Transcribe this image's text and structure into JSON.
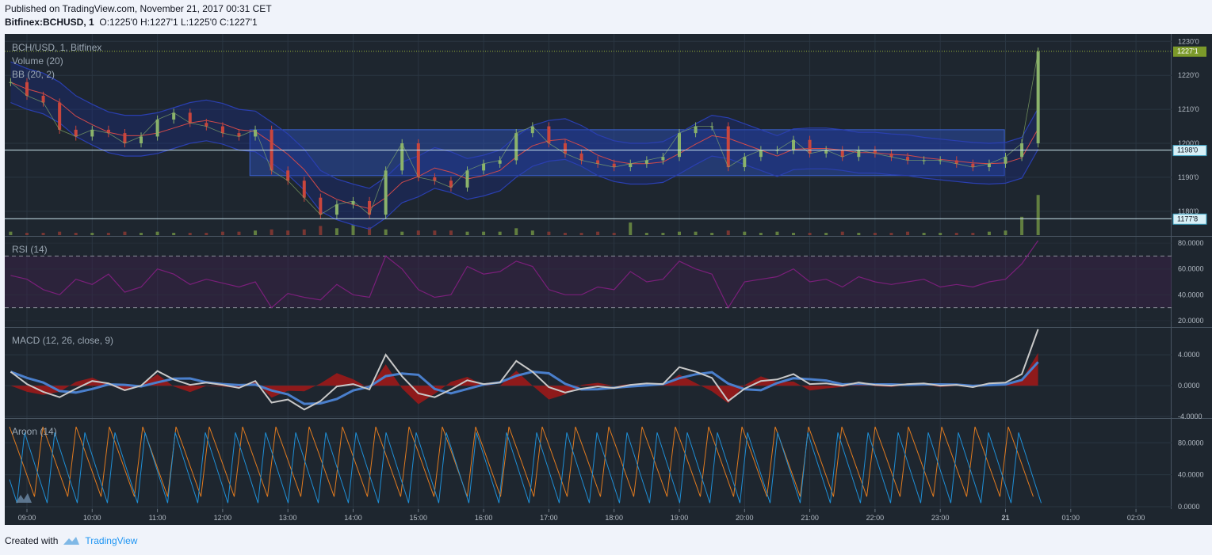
{
  "header": {
    "published": "Published on TradingView.com, November 21, 2017 00:31 CET",
    "symbol": "Bitfinex:BCHUSD, 1",
    "ohlc": "O:1225'0 H:1227'1 L:1225'0 C:1227'1"
  },
  "footer": {
    "created_with": "Created with",
    "brand": "TradingView"
  },
  "colors": {
    "background": "#1e262f",
    "grid": "#2a3642",
    "candle_up": "#8bb36b",
    "candle_down": "#c9463d",
    "bb_band": "#1a2d8c",
    "bb_mid": "#d24a4a",
    "box": "#2a4aa8",
    "hline": "#cce6ef",
    "rsi": "#7a1f7a",
    "macd": "#c8c8c8",
    "signal": "#4a7fcc",
    "hist": "#9b1a1a",
    "aroon_up": "#e07a1f",
    "aroon_down": "#1f8fd6",
    "last_price_tag": "#7c9a2a"
  },
  "price_pane": {
    "title": "BCH/USD, 1, Bitfinex",
    "volume_label": "Volume (20)",
    "bb_label": "BB (20, 2)",
    "ticks": [
      "1230'0",
      "1220'0",
      "1210'0",
      "1200'0",
      "1190'0",
      "1180'0"
    ],
    "last_price": "1227'1",
    "levels": [
      {
        "label": "1198'0",
        "value": 1198.0
      },
      {
        "label": "1177'8",
        "value": 1177.8
      }
    ],
    "range": [
      1173,
      1232
    ],
    "box": {
      "from": "12:25",
      "to": "23:59",
      "low": 1190.5,
      "high": 1204.0
    }
  },
  "rsi_pane": {
    "label": "RSI (14)",
    "ticks": [
      "80.0000",
      "60.0000",
      "40.0000",
      "20.0000"
    ],
    "range": [
      15,
      85
    ],
    "upper": 70,
    "lower": 30
  },
  "macd_pane": {
    "label": "MACD (12, 26, close, 9)",
    "ticks": [
      "4.0000",
      "0.0000",
      "-4.0000"
    ],
    "range": [
      -4.2,
      7.5
    ]
  },
  "aroon_pane": {
    "label": "Aroon (14)",
    "ticks": [
      "80.0000",
      "40.0000",
      "0.0000"
    ],
    "range": [
      -3,
      110
    ]
  },
  "time_axis": [
    "09:00",
    "10:00",
    "11:00",
    "12:00",
    "13:00",
    "14:00",
    "15:00",
    "16:00",
    "17:00",
    "18:00",
    "19:00",
    "20:00",
    "21:00",
    "22:00",
    "23:00",
    "21",
    "01:00",
    "02:00"
  ],
  "chart_data": {
    "type": "line",
    "title": "BCH/USD, 1, Bitfinex",
    "xlabel": "",
    "ylabel": "",
    "x_ticks": [
      "09:00",
      "10:00",
      "11:00",
      "12:00",
      "13:00",
      "14:00",
      "15:00",
      "16:00",
      "17:00",
      "18:00",
      "19:00",
      "20:00",
      "21:00",
      "22:00",
      "23:00",
      "21",
      "01:00",
      "02:00"
    ],
    "ylim": [
      1173,
      1232
    ],
    "x": [
      "08:45",
      "09:00",
      "09:15",
      "09:30",
      "09:45",
      "10:00",
      "10:15",
      "10:30",
      "10:45",
      "11:00",
      "11:15",
      "11:30",
      "11:45",
      "12:00",
      "12:15",
      "12:30",
      "12:45",
      "13:00",
      "13:15",
      "13:30",
      "13:45",
      "14:00",
      "14:15",
      "14:30",
      "14:45",
      "15:00",
      "15:15",
      "15:30",
      "15:45",
      "16:00",
      "16:15",
      "16:30",
      "16:45",
      "17:00",
      "17:15",
      "17:30",
      "17:45",
      "18:00",
      "18:15",
      "18:30",
      "18:45",
      "19:00",
      "19:15",
      "19:30",
      "19:45",
      "20:00",
      "20:15",
      "20:30",
      "20:45",
      "21:00",
      "21:15",
      "21:30",
      "21:45",
      "22:00",
      "22:15",
      "22:30",
      "22:45",
      "23:00",
      "23:15",
      "23:30",
      "23:45",
      "00:00",
      "00:15",
      "00:30"
    ],
    "series": [
      {
        "values": [
          1218,
          1214,
          1212,
          1204,
          1202,
          1204,
          1203,
          1200,
          1202,
          1207,
          1209,
          1206,
          1205,
          1203,
          1202,
          1204,
          1192,
          1189,
          1184,
          1179,
          1182,
          1183,
          1179,
          1192,
          1200,
          1190,
          1189,
          1187,
          1192,
          1194,
          1195,
          1203,
          1205,
          1200,
          1197,
          1195,
          1194,
          1193,
          1194,
          1195,
          1196,
          1203,
          1205,
          1205,
          1193,
          1196,
          1198,
          1198,
          1201,
          1197,
          1198,
          1196,
          1198,
          1197,
          1196,
          1195,
          1195,
          1195,
          1194,
          1193,
          1194,
          1196,
          1200,
          1227
        ]
      }
    ],
    "volume": [
      3,
      2,
      2,
      3,
      2,
      2,
      2,
      3,
      2,
      3,
      2,
      2,
      2,
      3,
      3,
      4,
      5,
      4,
      5,
      8,
      6,
      9,
      7,
      5,
      3,
      4,
      4,
      4,
      3,
      3,
      3,
      6,
      4,
      3,
      2,
      2,
      3,
      2,
      11,
      2,
      2,
      3,
      3,
      2,
      4,
      3,
      2,
      3,
      2,
      2,
      2,
      3,
      2,
      2,
      2,
      3,
      2,
      2,
      2,
      2,
      3,
      4,
      16,
      35
    ],
    "rsi": [
      55,
      52,
      44,
      40,
      52,
      48,
      56,
      42,
      46,
      60,
      56,
      48,
      52,
      49,
      46,
      50,
      30,
      41,
      38,
      36,
      48,
      40,
      38,
      70,
      60,
      44,
      38,
      40,
      62,
      56,
      58,
      66,
      62,
      44,
      40,
      40,
      46,
      44,
      58,
      50,
      52,
      66,
      60,
      56,
      30,
      50,
      52,
      54,
      60,
      50,
      52,
      46,
      54,
      50,
      48,
      50,
      52,
      46,
      48,
      46,
      50,
      52,
      64,
      82
    ],
    "macd": [
      1.8,
      0.2,
      -0.8,
      -1.5,
      -0.4,
      0.6,
      0.3,
      -0.6,
      0.0,
      1.9,
      0.8,
      0.1,
      0.4,
      0.1,
      -0.3,
      0.6,
      -2.2,
      -1.8,
      -3.1,
      -2.0,
      -0.1,
      0.2,
      -0.5,
      4.0,
      1.2,
      -1.0,
      -1.5,
      -0.5,
      0.7,
      0.2,
      0.4,
      3.2,
      1.8,
      -0.2,
      -0.9,
      -0.4,
      -0.1,
      -0.3,
      0.1,
      0.3,
      0.2,
      2.4,
      1.8,
      1.0,
      -2.0,
      -0.4,
      0.6,
      0.8,
      1.5,
      0.2,
      0.3,
      0.0,
      0.4,
      0.1,
      0.0,
      0.2,
      0.3,
      0.0,
      0.1,
      -0.2,
      0.3,
      0.4,
      1.5,
      7.3
    ]
  }
}
